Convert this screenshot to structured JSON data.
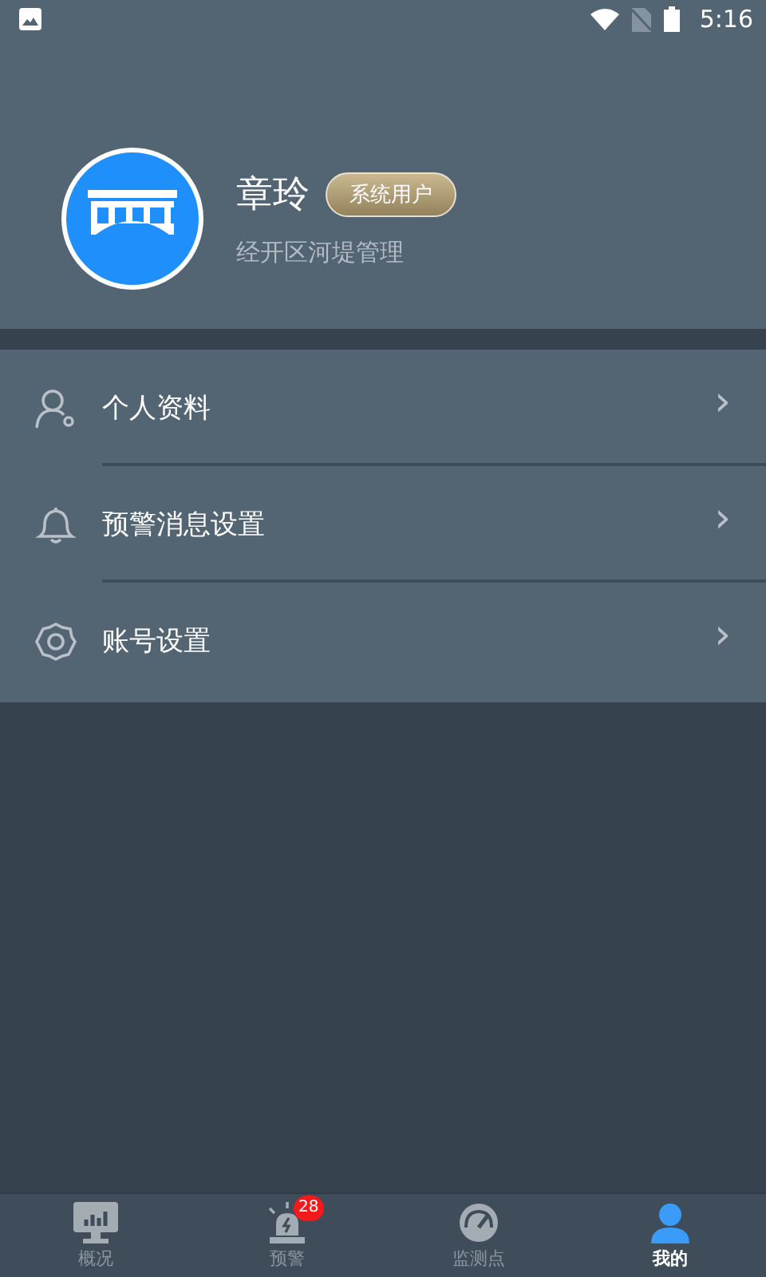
{
  "status_bar": {
    "time": "5:16"
  },
  "profile": {
    "name": "章玲",
    "role_badge": "系统用户",
    "department": "经开区河堤管理"
  },
  "menu": [
    {
      "kind": "profile",
      "label": "个人资料",
      "chevron": "›"
    },
    {
      "kind": "alert",
      "label": "预警消息设置",
      "chevron": "›"
    },
    {
      "kind": "account",
      "label": "账号设置",
      "chevron": "›"
    }
  ],
  "tab_bar": [
    {
      "kind": "overview",
      "label": "概况",
      "selected": false
    },
    {
      "kind": "alert",
      "label": "预警",
      "badge": "28",
      "selected": false
    },
    {
      "kind": "monitor",
      "label": "监测点",
      "selected": false
    },
    {
      "kind": "me",
      "label": "我的",
      "selected": true
    }
  ]
}
